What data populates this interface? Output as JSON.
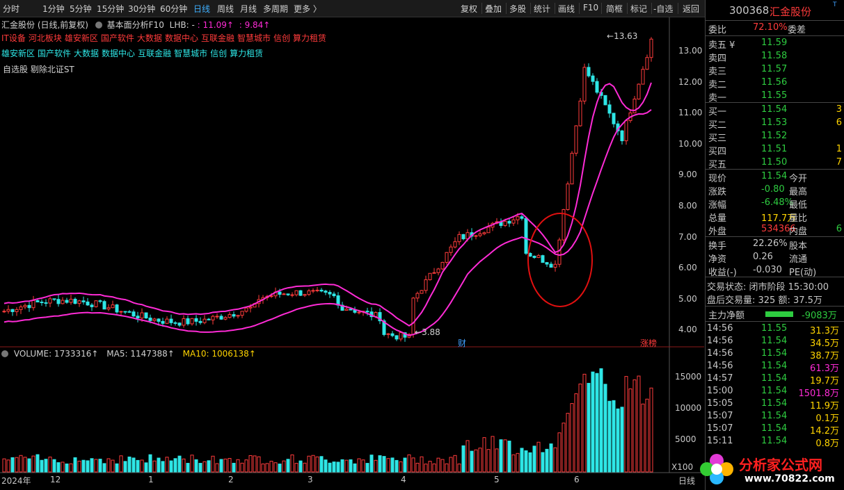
{
  "toolbar": {
    "periods": [
      "分时",
      "1分钟",
      "5分钟",
      "15分钟",
      "30分钟",
      "60分钟",
      "日线",
      "周线",
      "月线",
      "多周期",
      "更多 〉"
    ],
    "active_period": "日线",
    "right_buttons": [
      "复权",
      "叠加",
      "多股",
      "统计",
      "画线",
      "F10",
      "简框",
      "标记",
      "-自选",
      "返回"
    ]
  },
  "chart": {
    "title": "汇金股份 (日线,前复权)",
    "f10_label": "基本面分析F10",
    "lhb_label": "LHB: -",
    "lhb_high": ": 11.09↑",
    "lhb_low": ": 9.84↑",
    "concept_red": [
      "IT设备",
      "河北板块",
      "雄安新区",
      "国产软件",
      "大数据",
      "数据中心",
      "互联金融",
      "智慧城市",
      "信创",
      "算力租赁"
    ],
    "concept_cyan": [
      "雄安新区",
      "国产软件",
      "大数据",
      "数据中心",
      "互联金融",
      "智慧城市",
      "信创",
      "算力租赁"
    ],
    "tags": "自选股  剔除北证ST",
    "high_marker": "13.63",
    "low_marker": "3.88",
    "marker_cai": "财",
    "marker_zb": "涨榜",
    "y_ticks": [
      "13.00",
      "12.00",
      "11.00",
      "10.00",
      "9.00",
      "8.00",
      "7.00",
      "6.00",
      "5.00",
      "4.00"
    ],
    "vol_label": "VOLUME: 1733316↑",
    "ma5_label": "MA5: 1147388↑",
    "ma10_label": "MA10: 1006138↑",
    "vol_ticks": [
      "15000",
      "10000",
      "5000"
    ],
    "vol_unit": "X100",
    "x_labels": [
      "2024年",
      "12",
      "1",
      "2",
      "3",
      "4",
      "5",
      "6"
    ],
    "axis_corner": "日线",
    "colors": {
      "up": "#ff3b3b",
      "down": "#2ee6e6",
      "ma1": "#ff2bd6",
      "ma2": "#2ecc40",
      "ma10": "#ffd400"
    }
  },
  "quote": {
    "code": "300368",
    "name": "汇金股份",
    "weibi_label": "委比",
    "weibi": "72.10%",
    "weicha_label": "委差",
    "asks": [
      {
        "label": "卖五 ¥",
        "price": "11.59",
        "vol": ""
      },
      {
        "label": "卖四",
        "price": "11.58",
        "vol": ""
      },
      {
        "label": "卖三",
        "price": "11.57",
        "vol": ""
      },
      {
        "label": "卖二",
        "price": "11.56",
        "vol": ""
      },
      {
        "label": "卖一",
        "price": "11.55",
        "vol": ""
      }
    ],
    "bids": [
      {
        "label": "买一",
        "price": "11.54",
        "vol": "3"
      },
      {
        "label": "买二",
        "price": "11.53",
        "vol": "6"
      },
      {
        "label": "买三",
        "price": "11.52",
        "vol": ""
      },
      {
        "label": "买四",
        "price": "11.51",
        "vol": "1"
      },
      {
        "label": "买五",
        "price": "11.50",
        "vol": "7"
      }
    ],
    "stats": [
      {
        "l1": "现价",
        "v1": "11.54",
        "l2": "今开",
        "v2": ""
      },
      {
        "l1": "涨跌",
        "v1": "-0.80",
        "l2": "最高",
        "v2": ""
      },
      {
        "l1": "涨幅",
        "v1": "-6.48%",
        "l2": "最低",
        "v2": ""
      },
      {
        "l1": "总量",
        "v1": "117.7万",
        "l2": "量比",
        "v2": ""
      },
      {
        "l1": "外盘",
        "v1": "534366",
        "l2": "内盘",
        "v2": "6"
      }
    ],
    "stats2": [
      {
        "l1": "换手",
        "v1": "22.26%",
        "l2": "股本"
      },
      {
        "l1": "净资",
        "v1": "0.26",
        "l2": "流通"
      },
      {
        "l1": "收益(-)",
        "v1": "-0.030",
        "l2": "PE(动)"
      }
    ],
    "status_text": "交易状态: 闭市阶段 15:30:00",
    "after_hours": "盘后交易量: 325  额: 37.5万",
    "main_flow_label": "主力净额",
    "main_flow_value": "-9083万",
    "ticks": [
      {
        "t": "14:56",
        "p": "11.55",
        "v": "31.3万",
        "c": "yel"
      },
      {
        "t": "14:56",
        "p": "11.54",
        "v": "34.5万",
        "c": "yel"
      },
      {
        "t": "14:56",
        "p": "11.54",
        "v": "38.7万",
        "c": "yel"
      },
      {
        "t": "14:56",
        "p": "11.54",
        "v": "61.3万",
        "c": "mag"
      },
      {
        "t": "14:57",
        "p": "11.54",
        "v": "19.7万",
        "c": "yel"
      },
      {
        "t": "15:00",
        "p": "11.54",
        "v": "1501.8万",
        "c": "mag"
      },
      {
        "t": "15:05",
        "p": "11.54",
        "v": "11.9万",
        "c": "yel"
      },
      {
        "t": "15:07",
        "p": "11.54",
        "v": "0.1万",
        "c": "yel"
      },
      {
        "t": "15:07",
        "p": "11.54",
        "v": "14.2万",
        "c": "yel"
      },
      {
        "t": "15:11",
        "p": "11.54",
        "v": "0.8万",
        "c": "yel"
      }
    ],
    "logo_text": "分析家公式网",
    "logo_url": "www.70822.com"
  }
}
